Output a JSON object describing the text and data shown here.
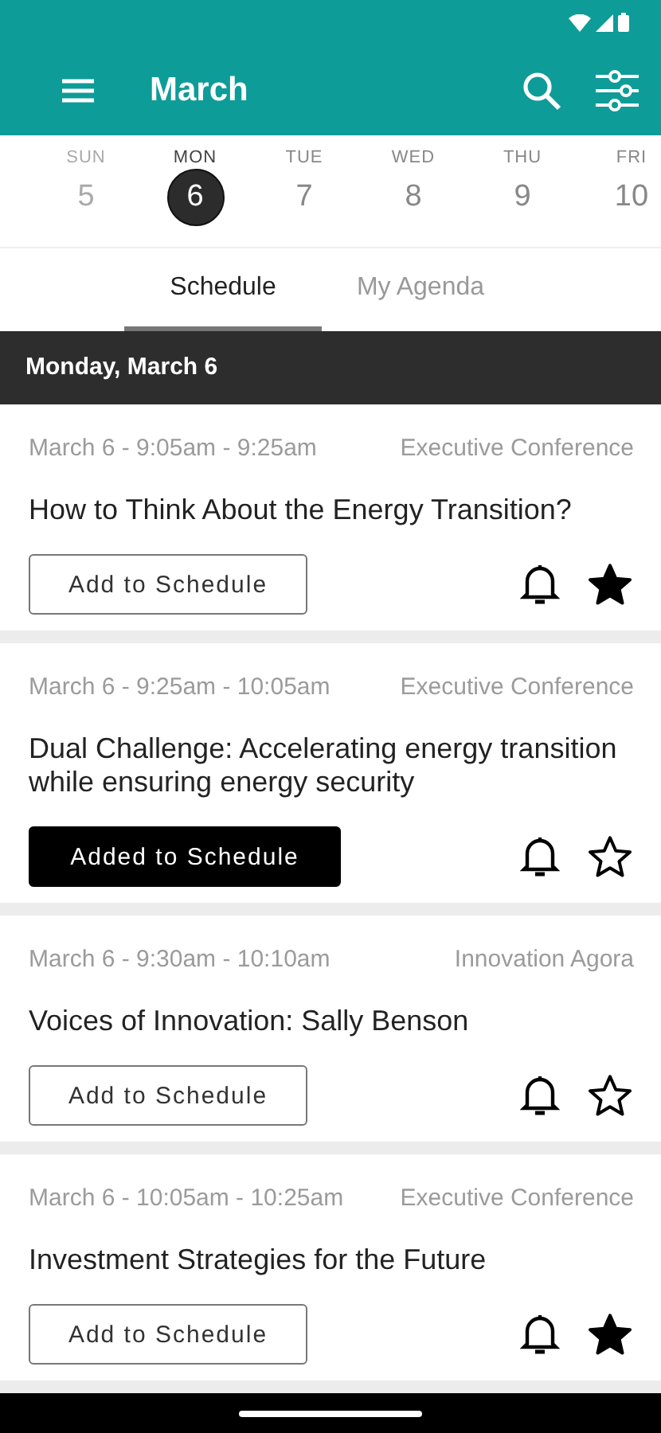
{
  "app_bar": {
    "title": "March"
  },
  "days": [
    {
      "weekday": "SUN",
      "date": "5",
      "selected": false,
      "disabled": true
    },
    {
      "weekday": "MON",
      "date": "6",
      "selected": true,
      "disabled": false
    },
    {
      "weekday": "TUE",
      "date": "7",
      "selected": false,
      "disabled": false
    },
    {
      "weekday": "WED",
      "date": "8",
      "selected": false,
      "disabled": false
    },
    {
      "weekday": "THU",
      "date": "9",
      "selected": false,
      "disabled": false
    },
    {
      "weekday": "FRI",
      "date": "10",
      "selected": false,
      "disabled": false
    }
  ],
  "tabs": [
    {
      "label": "Schedule",
      "selected": true
    },
    {
      "label": "My Agenda",
      "selected": false
    }
  ],
  "section_header": "Monday, March 6",
  "sessions": [
    {
      "time": "March 6 - 9:05am - 9:25am",
      "venue": "Executive Conference",
      "title": "How to Think About the Energy Transition?",
      "button": "Add to Schedule",
      "added": false,
      "starred": true
    },
    {
      "time": "March 6 - 9:25am - 10:05am",
      "venue": "Executive Conference",
      "title": "Dual Challenge: Accelerating energy transition while ensuring energy security",
      "button": "Added to Schedule",
      "added": true,
      "starred": false
    },
    {
      "time": "March 6 - 9:30am - 10:10am",
      "venue": "Innovation Agora",
      "title": "Voices of Innovation: Sally Benson",
      "button": "Add to Schedule",
      "added": false,
      "starred": false
    },
    {
      "time": "March 6 - 10:05am - 10:25am",
      "venue": "Executive Conference",
      "title": "Investment Strategies for the Future",
      "button": "Add to Schedule",
      "added": false,
      "starred": true
    }
  ]
}
